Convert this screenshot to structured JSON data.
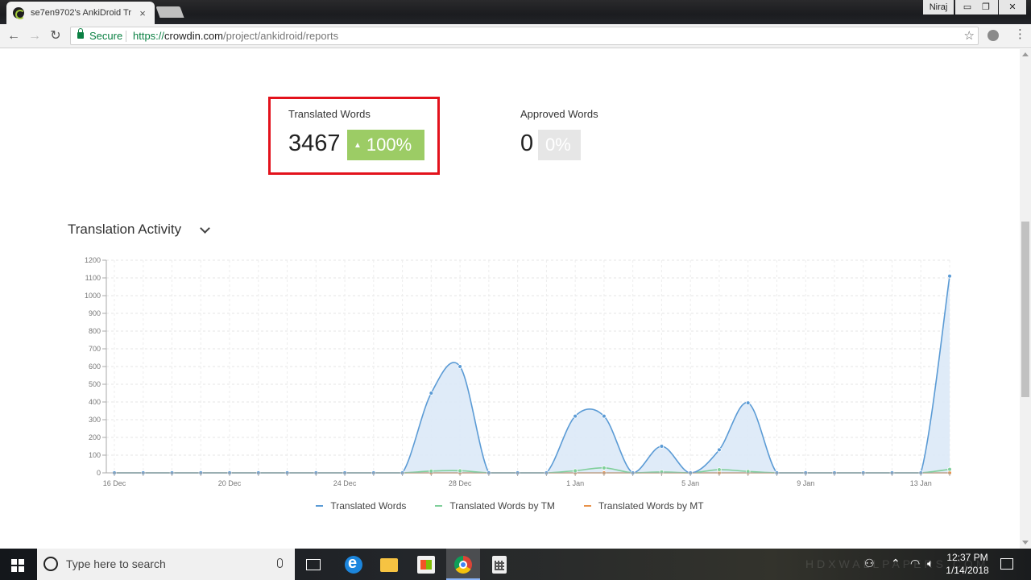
{
  "browser": {
    "tab_title": "se7en9702's AnkiDroid Tr",
    "tab_close": "×",
    "user_name": "Niraj",
    "window_controls": {
      "minimize": "▭",
      "restore": "❐",
      "close": "✕"
    },
    "nav": {
      "back": "←",
      "forward": "→",
      "reload": "↻"
    },
    "secure_label": "Secure",
    "url_scheme": "https://",
    "url_host": "crowdin.com",
    "url_path": "/project/ankidroid/reports",
    "star": "☆",
    "menu": "⋮"
  },
  "stats": {
    "translated": {
      "title": "Translated Words",
      "value": "3467",
      "percent": "100%",
      "trend": "▲"
    },
    "approved": {
      "title": "Approved Words",
      "value": "0",
      "percent": "0%"
    }
  },
  "activity": {
    "title": "Translation Activity"
  },
  "chart_data": {
    "type": "area",
    "title": "",
    "xlabel": "",
    "ylabel": "",
    "ylim": [
      0,
      1200
    ],
    "yticks": [
      0,
      100,
      200,
      300,
      400,
      500,
      600,
      700,
      800,
      900,
      1000,
      1100,
      1200
    ],
    "x": [
      "16 Dec",
      "17 Dec",
      "18 Dec",
      "19 Dec",
      "20 Dec",
      "21 Dec",
      "22 Dec",
      "23 Dec",
      "24 Dec",
      "25 Dec",
      "26 Dec",
      "27 Dec",
      "28 Dec",
      "29 Dec",
      "30 Dec",
      "31 Dec",
      "1 Jan",
      "2 Jan",
      "3 Jan",
      "4 Jan",
      "5 Jan",
      "6 Jan",
      "7 Jan",
      "8 Jan",
      "9 Jan",
      "10 Jan",
      "11 Jan",
      "12 Jan",
      "13 Jan",
      "14 Jan"
    ],
    "xtick_labels": {
      "0": "16 Dec",
      "4": "20 Dec",
      "8": "24 Dec",
      "12": "28 Dec",
      "16": "1 Jan",
      "20": "5 Jan",
      "24": "9 Jan",
      "28": "13 Jan"
    },
    "grid": true,
    "legend": "bottom",
    "series": [
      {
        "name": "Translated Words",
        "color": "#5b9bd5",
        "fill": "#dce9f7",
        "values": [
          0,
          0,
          0,
          0,
          0,
          0,
          0,
          0,
          0,
          0,
          0,
          450,
          600,
          0,
          0,
          0,
          320,
          320,
          0,
          150,
          0,
          130,
          395,
          0,
          0,
          0,
          0,
          0,
          0,
          1110
        ]
      },
      {
        "name": "Translated Words by TM",
        "color": "#7fcf9a",
        "values": [
          0,
          0,
          0,
          0,
          0,
          0,
          0,
          0,
          0,
          0,
          0,
          10,
          12,
          0,
          0,
          0,
          12,
          28,
          0,
          5,
          0,
          18,
          8,
          0,
          0,
          0,
          0,
          0,
          0,
          20
        ]
      },
      {
        "name": "Translated Words by MT",
        "color": "#e8924a",
        "values": [
          0,
          0,
          0,
          0,
          0,
          0,
          0,
          0,
          0,
          0,
          0,
          0,
          0,
          0,
          0,
          0,
          0,
          0,
          0,
          0,
          0,
          0,
          0,
          0,
          0,
          0,
          0,
          0,
          0,
          0
        ]
      }
    ]
  },
  "taskbar": {
    "search_placeholder": "Type here to search",
    "time": "12:37 PM",
    "date": "1/14/2018",
    "watermark": "HDXWALLPAPERS.COM"
  }
}
